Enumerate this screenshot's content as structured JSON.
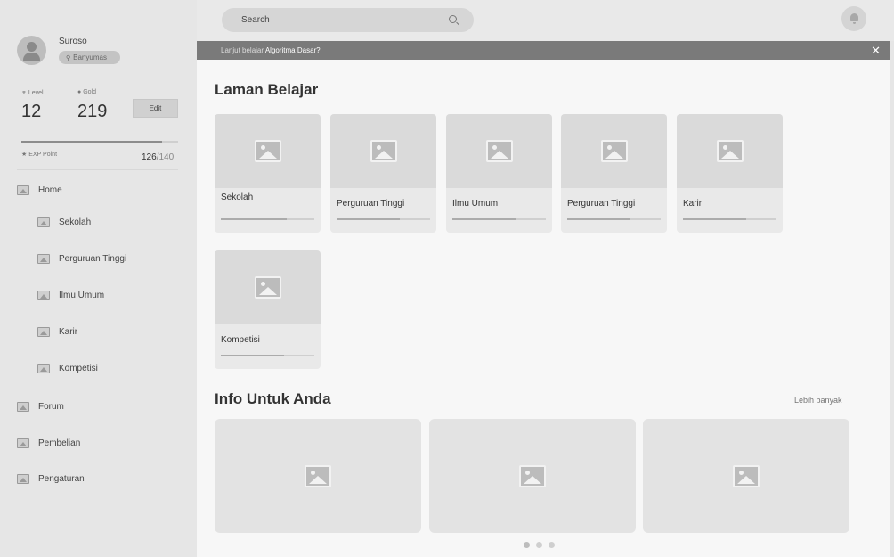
{
  "user": {
    "name": "Suroso",
    "location": "Banyumas",
    "level_label": "Level",
    "level_value": "12",
    "gold_label": "Gold",
    "gold_value": "219",
    "edit_label": "Edit",
    "exp_label": "EXP Point",
    "exp_current": "126",
    "exp_total": "/140",
    "exp_progress": 0.9
  },
  "sidebar": {
    "items": [
      {
        "label": "Home",
        "icon": "image-icon",
        "level": 0
      },
      {
        "label": "Sekolah",
        "icon": "image-icon",
        "level": 1
      },
      {
        "label": "Perguruan Tinggi",
        "icon": "image-icon",
        "level": 1
      },
      {
        "label": "Ilmu Umum",
        "icon": "image-icon",
        "level": 1
      },
      {
        "label": "Karir",
        "icon": "image-icon",
        "level": 1
      },
      {
        "label": "Kompetisi",
        "icon": "image-icon",
        "level": 1
      },
      {
        "label": "Forum",
        "icon": "image-icon",
        "level": 0
      },
      {
        "label": "Pembelian",
        "icon": "image-icon",
        "level": 0
      },
      {
        "label": "Pengaturan",
        "icon": "image-icon",
        "level": 0
      }
    ]
  },
  "header": {
    "search_placeholder": "Search",
    "notification_icon": "bell-icon"
  },
  "banner": {
    "prefix": "Lanjut belajar ",
    "course": "Algoritma Dasar?",
    "close_glyph": "✕"
  },
  "learning": {
    "title": "Laman Belajar",
    "cards": [
      {
        "title": "Sekolah",
        "progress": 0.7
      },
      {
        "title": "Perguruan Tinggi",
        "progress": 0.68
      },
      {
        "title": "Ilmu Umum",
        "progress": 0.68
      },
      {
        "title": "Perguruan Tinggi",
        "progress": 0.68
      },
      {
        "title": "Karir",
        "progress": 0.68
      },
      {
        "title": "Kompetisi",
        "progress": 0.68
      }
    ]
  },
  "info": {
    "title": "Info Untuk Anda",
    "more_label": "Lebih banyak",
    "card_count": 3,
    "carousel_pages": 3,
    "active_page": 0
  },
  "colors": {
    "sidebar_bg": "#e6e6e6",
    "banner_bg": "#7a7a7a",
    "card_bg": "#e9e9e9",
    "image_placeholder": "#dadada"
  }
}
